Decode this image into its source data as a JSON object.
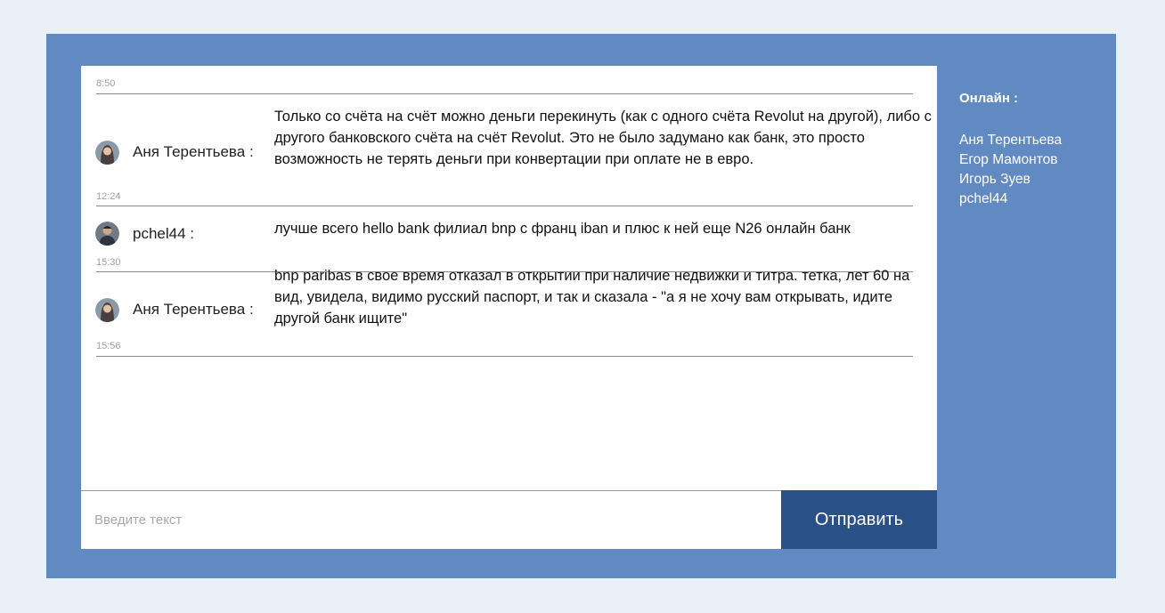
{
  "chat": {
    "top_time": "8:50",
    "messages": [
      {
        "author": "Аня Терентьева :",
        "time": "12:24",
        "text": "Только со счёта на счёт можно деньги перекинуть (как с одного счёта Revolut на другой), либо с другого банковского счёта на счёт Revolut. Это не было задумано как банк, это просто возможность не терять деньги при конвертации при оплате не в евро."
      },
      {
        "author": "pchel44 :",
        "time": "15:30",
        "text": "лучше всего hello bank филиал bnp с франц iban и плюс к ней еще N26 онлайн банк"
      },
      {
        "author": "Аня Терентьева :",
        "time": "15:56",
        "text": "bnp paribas в свое время отказал в открытии при наличие недвижки и титра. тетка, лет 60 на вид, увидела, видимо русский паспорт, и так и сказала - \"а я не хочу вам открывать, идите другой банк ищите\""
      }
    ]
  },
  "composer": {
    "placeholder": "Введите текст",
    "send_label": "Отправить"
  },
  "online": {
    "title": "Онлайн :",
    "users": [
      "Аня Терентьева",
      "Егор Мамонтов",
      "Игорь Зуев",
      "pchel44"
    ]
  },
  "colors": {
    "page_bg": "#e9f0f8",
    "frame_bg": "#6189c2",
    "send_button": "#2a5187"
  }
}
